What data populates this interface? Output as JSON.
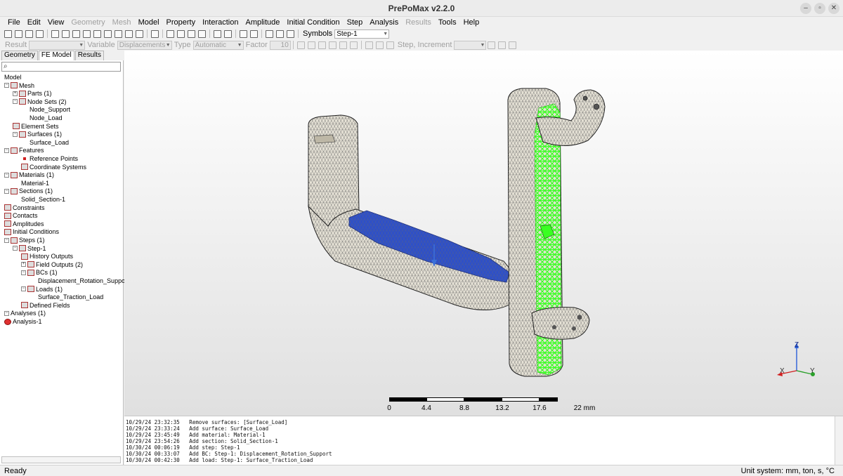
{
  "window": {
    "title": "PrePoMax v2.2.0",
    "minimize": "–",
    "maximize": "▫",
    "close": "✕"
  },
  "menu": [
    {
      "label": "File",
      "enabled": true
    },
    {
      "label": "Edit",
      "enabled": true
    },
    {
      "label": "View",
      "enabled": true
    },
    {
      "label": "Geometry",
      "enabled": false
    },
    {
      "label": "Mesh",
      "enabled": false
    },
    {
      "label": "Model",
      "enabled": true
    },
    {
      "label": "Property",
      "enabled": true
    },
    {
      "label": "Interaction",
      "enabled": true
    },
    {
      "label": "Amplitude",
      "enabled": true
    },
    {
      "label": "Initial Condition",
      "enabled": true
    },
    {
      "label": "Step",
      "enabled": true
    },
    {
      "label": "Analysis",
      "enabled": true
    },
    {
      "label": "Results",
      "enabled": false
    },
    {
      "label": "Tools",
      "enabled": true
    },
    {
      "label": "Help",
      "enabled": true
    }
  ],
  "toolbar1": {
    "symbols_label": "Symbols",
    "step_value": "Step-1"
  },
  "toolbar2": {
    "result_label": "Result",
    "result_value": "",
    "variable_label": "Variable",
    "variable_value": "Displacements",
    "type_label": "Type",
    "type_value": "Automatic",
    "factor_label": "Factor",
    "factor_value": "10",
    "step_increment_label": "Step, Increment",
    "step_increment_value": ""
  },
  "left_panel": {
    "tabs": [
      {
        "label": "Geometry",
        "active": false
      },
      {
        "label": "FE Model",
        "active": true
      },
      {
        "label": "Results",
        "active": false
      }
    ],
    "search_icon": "⌕",
    "tree": [
      {
        "label": "Model",
        "level": 0,
        "icon": "none",
        "expander": ""
      },
      {
        "label": "Mesh",
        "level": 0,
        "icon": "mesh-icon",
        "expander": "−"
      },
      {
        "label": "Parts (1)",
        "level": 1,
        "icon": "parts-icon",
        "expander": "+"
      },
      {
        "label": "Node Sets (2)",
        "level": 1,
        "icon": "node-sets-icon",
        "expander": "−"
      },
      {
        "label": "Node_Support",
        "level": 3,
        "icon": "none",
        "expander": ""
      },
      {
        "label": "Node_Load",
        "level": 3,
        "icon": "none",
        "expander": ""
      },
      {
        "label": "Element Sets",
        "level": 1,
        "icon": "element-sets-icon",
        "expander": ""
      },
      {
        "label": "Surfaces (1)",
        "level": 1,
        "icon": "surfaces-icon",
        "expander": "−"
      },
      {
        "label": "Surface_Load",
        "level": 3,
        "icon": "none",
        "expander": ""
      },
      {
        "label": "Features",
        "level": 0,
        "icon": "features-icon",
        "expander": "−"
      },
      {
        "label": "Reference Points",
        "level": 2,
        "icon": "reference-points-icon",
        "expander": ""
      },
      {
        "label": "Coordinate Systems",
        "level": 2,
        "icon": "coordinate-systems-icon",
        "expander": ""
      },
      {
        "label": "Materials (1)",
        "level": 0,
        "icon": "materials-icon",
        "expander": "−"
      },
      {
        "label": "Material-1",
        "level": 2,
        "icon": "none",
        "expander": ""
      },
      {
        "label": "Sections (1)",
        "level": 0,
        "icon": "sections-icon",
        "expander": "−"
      },
      {
        "label": "Solid_Section-1",
        "level": 2,
        "icon": "none",
        "expander": ""
      },
      {
        "label": "Constraints",
        "level": 0,
        "icon": "constraints-icon",
        "expander": ""
      },
      {
        "label": "Contacts",
        "level": 0,
        "icon": "contacts-icon",
        "expander": ""
      },
      {
        "label": "Amplitudes",
        "level": 0,
        "icon": "amplitudes-icon",
        "expander": ""
      },
      {
        "label": "Initial Conditions",
        "level": 0,
        "icon": "initial-conditions-icon",
        "expander": ""
      },
      {
        "label": "Steps (1)",
        "level": 0,
        "icon": "steps-icon",
        "expander": "−"
      },
      {
        "label": "Step-1",
        "level": 1,
        "icon": "step-icon",
        "expander": "−"
      },
      {
        "label": "History Outputs",
        "level": 2,
        "icon": "history-outputs-icon",
        "expander": ""
      },
      {
        "label": "Field Outputs (2)",
        "level": 2,
        "icon": "field-outputs-icon",
        "expander": "+"
      },
      {
        "label": "BCs (1)",
        "level": 2,
        "icon": "bcs-icon",
        "expander": "−"
      },
      {
        "label": "Displacement_Rotation_Support",
        "level": 4,
        "icon": "none",
        "expander": ""
      },
      {
        "label": "Loads (1)",
        "level": 2,
        "icon": "loads-icon",
        "expander": "−"
      },
      {
        "label": "Surface_Traction_Load",
        "level": 4,
        "icon": "none",
        "expander": ""
      },
      {
        "label": "Defined Fields",
        "level": 2,
        "icon": "defined-fields-icon",
        "expander": ""
      },
      {
        "label": "Analyses (1)",
        "level": 0,
        "icon": "none",
        "expander": "−"
      },
      {
        "label": "Analysis-1",
        "level": 0,
        "icon": "analysis-error-icon",
        "expander": ""
      }
    ]
  },
  "viewport": {
    "axes": {
      "x": "X",
      "y": "Y",
      "z": "Z"
    },
    "scale_unit": "22 mm",
    "scale_labels": [
      "0",
      "4.4",
      "8.8",
      "13.2",
      "17.6",
      "22 mm"
    ],
    "colors": {
      "mesh_body": "#e6e2d6",
      "load_surface": "#2d4fc9",
      "support_nodes": "#39ff22",
      "load_arrow": "#3b6fd8",
      "mesh_lines": "#6b6b6b"
    }
  },
  "log": [
    "10/29/24 23:32:35   Remove surfaces: [Surface_Load]",
    "10/29/24 23:33:24   Add surface: Surface_Load",
    "10/29/24 23:45:49   Add material: Material-1",
    "10/29/24 23:54:26   Add section: Solid_Section-1",
    "10/30/24 00:06:19   Add step: Step-1",
    "10/30/24 00:33:07   Add BC: Step-1: Displacement_Rotation_Support",
    "10/30/24 00:42:30   Add load: Step-1: Surface_Traction_Load"
  ],
  "status": {
    "left": "Ready",
    "right": "Unit system: mm, ton, s, °C"
  }
}
